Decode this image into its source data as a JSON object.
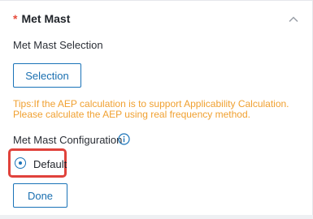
{
  "section": {
    "required_mark": "*",
    "title": "Met Mast"
  },
  "selection": {
    "label": "Met Mast Selection",
    "button_label": "Selection"
  },
  "tips": {
    "line1": "Tips:If the AEP calculation is to support Applicability Calculation.",
    "line2": "Please calculate the AEP using real frequency method."
  },
  "configuration": {
    "label": "Met Mast Configuration",
    "info_icon": "info-icon",
    "option_label": "Default",
    "option_selected": true,
    "done_label": "Done"
  },
  "colors": {
    "accent": "#1a73b8",
    "required": "#e74c3c",
    "tips": "#f0a030",
    "highlight_box": "#e0423b"
  }
}
